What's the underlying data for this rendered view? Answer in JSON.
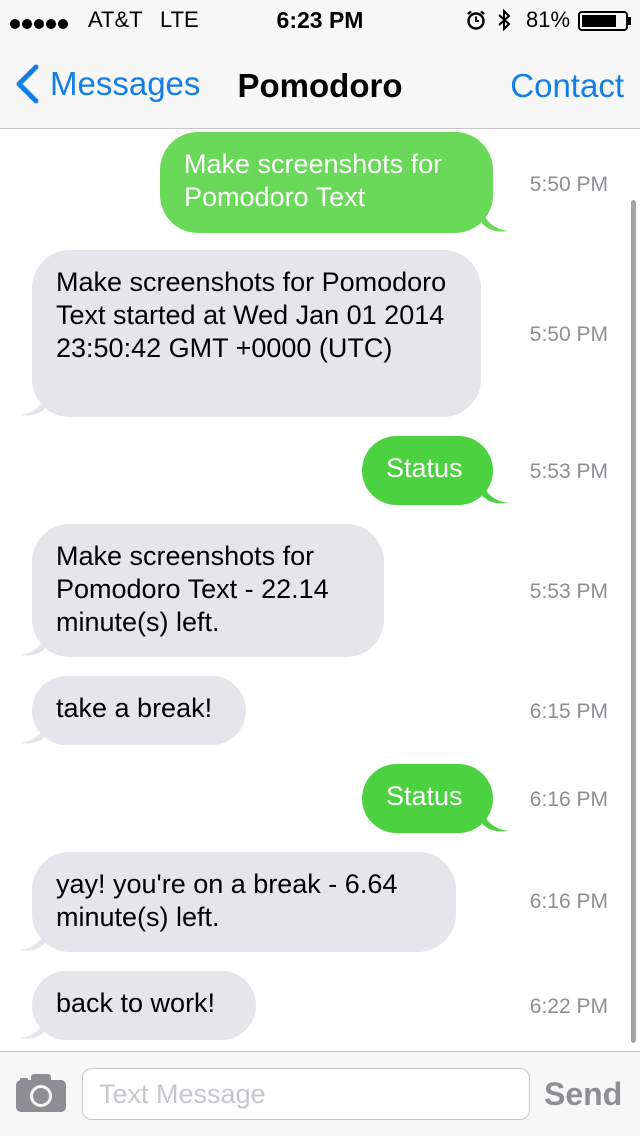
{
  "status_bar": {
    "carrier": "AT&T",
    "network": "LTE",
    "time": "6:23 PM",
    "battery_percent": "81%",
    "battery_level": 0.81,
    "signal_bars": 5,
    "icons": [
      "alarm-icon",
      "bluetooth-icon",
      "battery-icon"
    ]
  },
  "nav": {
    "back_label": "Messages",
    "title": "Pomodoro",
    "contact_label": "Contact",
    "accent_color": "#137ee6"
  },
  "messages": [
    {
      "direction": "sent",
      "text": "Make screenshots for Pomodoro Text",
      "time": "5:50 PM"
    },
    {
      "direction": "received",
      "text": "Make screenshots for Pomodoro Text started at Wed Jan 01 2014 23:50:42 GMT +0000 (UTC)",
      "time": "5:50 PM"
    },
    {
      "direction": "sent",
      "text": "Status",
      "time": "5:53 PM"
    },
    {
      "direction": "received",
      "text": "Make screenshots for Pomodoro Text - 22.14 minute(s) left.",
      "time": "5:53 PM"
    },
    {
      "direction": "received",
      "text": "take a break!",
      "time": "6:15 PM"
    },
    {
      "direction": "sent",
      "text": "Status",
      "time": "6:16 PM"
    },
    {
      "direction": "received",
      "text": "yay! you're on a break - 6.64 minute(s) left.",
      "time": "6:16 PM"
    },
    {
      "direction": "received",
      "text": "back to work!",
      "time": "6:22 PM"
    }
  ],
  "input": {
    "placeholder": "Text Message",
    "value": "",
    "send_label": "Send",
    "camera_icon": "camera-icon"
  },
  "colors": {
    "sent_bubble": "#6ad95a",
    "received_bubble": "#e5e5ea",
    "timestamp": "#8e8e93"
  }
}
